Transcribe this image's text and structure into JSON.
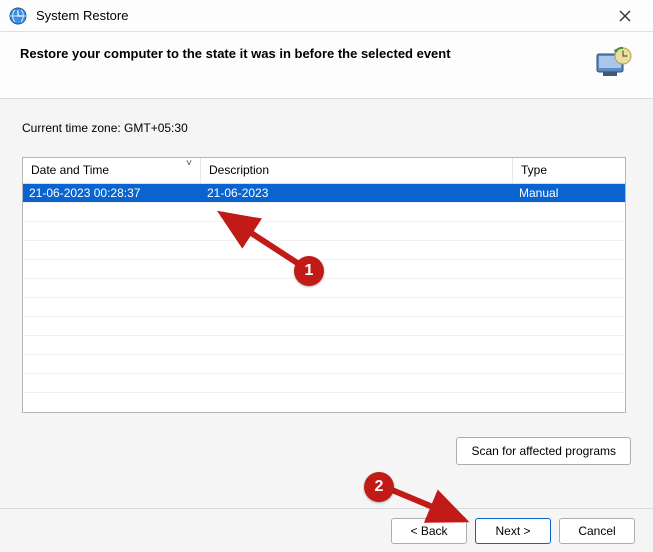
{
  "titlebar": {
    "title": "System Restore"
  },
  "header": {
    "heading": "Restore your computer to the state it was in before the selected event"
  },
  "timezone": {
    "label": "Current time zone: GMT+05:30"
  },
  "table": {
    "columns": {
      "date": "Date and Time",
      "desc": "Description",
      "type": "Type"
    },
    "rows": [
      {
        "date": "21-06-2023 00:28:37",
        "desc": "21-06-2023",
        "type": "Manual"
      }
    ]
  },
  "buttons": {
    "scan": "Scan for affected programs",
    "back": "< Back",
    "next": "Next >",
    "cancel": "Cancel"
  },
  "annotations": {
    "one": "1",
    "two": "2"
  }
}
